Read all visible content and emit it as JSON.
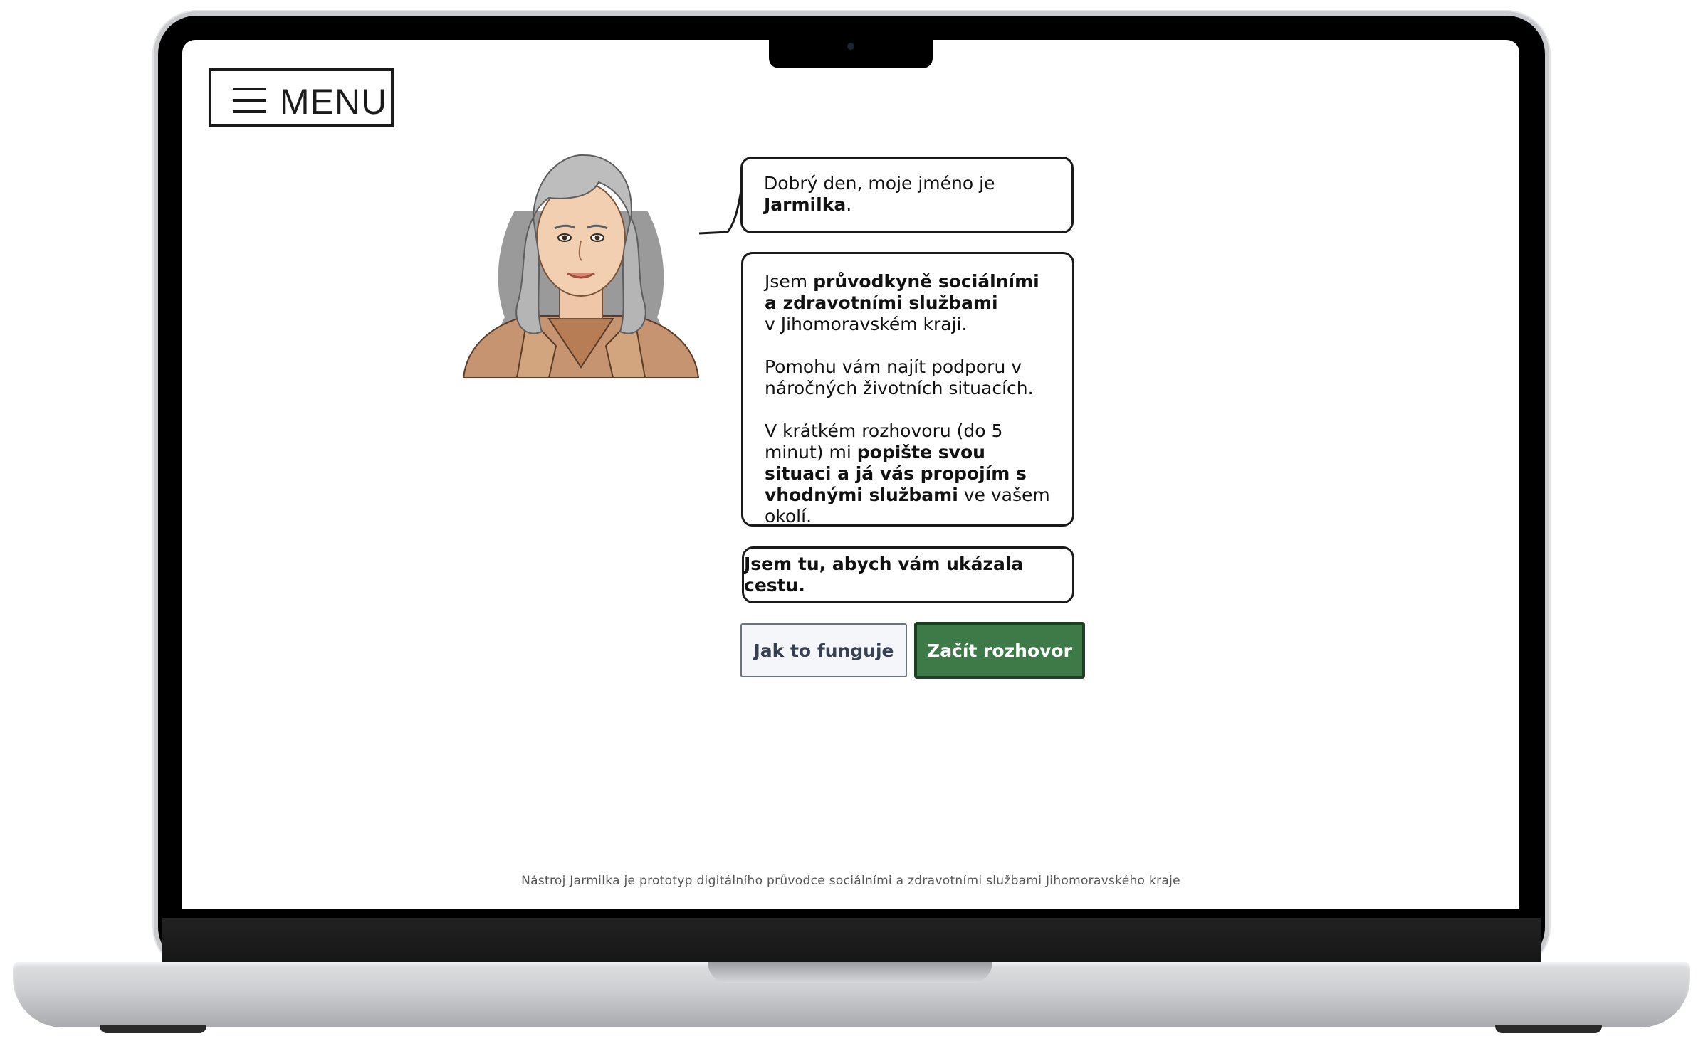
{
  "menu": {
    "label": "MENU"
  },
  "greeting": {
    "line1": "Dobrý den, moje jméno je",
    "name": "Jarmilka",
    "punct": "."
  },
  "intro": {
    "p1_pre": "Jsem ",
    "p1_bold": "průvodkyně sociálními a zdravotními službami",
    "p1_post": "v Jihomoravském kraji.",
    "p2": "Pomohu vám najít podporu v náročných životních situacích.",
    "p3_pre": "V krátkém rozhovoru (do 5 minut) mi ",
    "p3_bold": "popište svou situaci a já vás propojím s vhodnými službami",
    "p3_post": " ve vašem okolí."
  },
  "tagline": "Jsem tu, abych vám ukázala cestu.",
  "buttons": {
    "how": "Jak to funguje",
    "start": "Začít rozhovor"
  },
  "footer": "Nástroj Jarmilka je prototyp digitálního průvodce sociálními a zdravotními službami Jihomoravského kraje",
  "colors": {
    "primary": "#3d7a48",
    "primary_border": "#1f3f24",
    "secondary_bg": "#f5f6f9",
    "text": "#111111"
  },
  "icons": [
    "hamburger-icon",
    "camera-icon"
  ]
}
